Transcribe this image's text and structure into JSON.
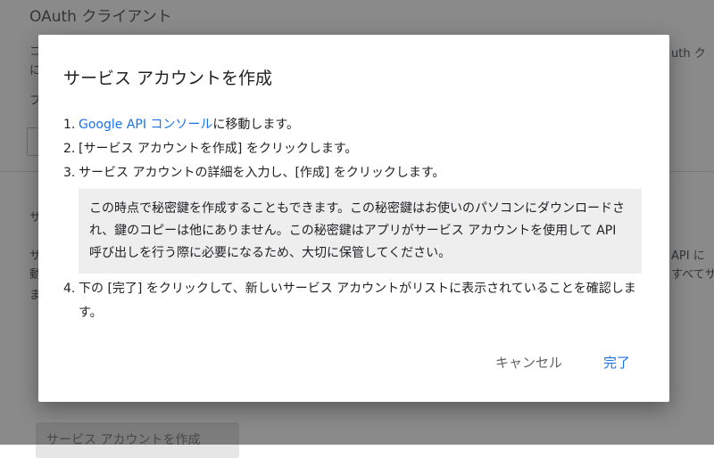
{
  "background": {
    "title": "OAuth クライアント",
    "fragments_left": [
      "コ",
      "に",
      "フ",
      "サ",
      "サ",
      "動",
      "ま"
    ],
    "fragments_right": [
      "uth ク",
      "API に",
      "すべてサ"
    ],
    "create_button": "サービス アカウントを作成"
  },
  "dialog": {
    "title": "サービス アカウントを作成",
    "steps": [
      {
        "num": "1.",
        "link": "Google API コンソール",
        "text": "に移動します。"
      },
      {
        "num": "2.",
        "text": "[サービス アカウントを作成] をクリックします。"
      },
      {
        "num": "3.",
        "text": "サービス アカウントの詳細を入力し、[作成] をクリックします。"
      },
      {
        "num": "4.",
        "text": "下の [完了] をクリックして、新しいサービス アカウントがリストに表示されていることを確認します。"
      }
    ],
    "note": "この時点で秘密鍵を作成することもできます。この秘密鍵はお使いのパソコンにダウンロードされ、鍵のコピーは他にありません。この秘密鍵はアプリがサービス アカウントを使用して API 呼び出しを行う際に必要になるため、大切に保管してください。",
    "cancel_label": "キャンセル",
    "done_label": "完了"
  },
  "colors": {
    "accent": "#1a73e8",
    "note_bg": "#eeeeee"
  }
}
